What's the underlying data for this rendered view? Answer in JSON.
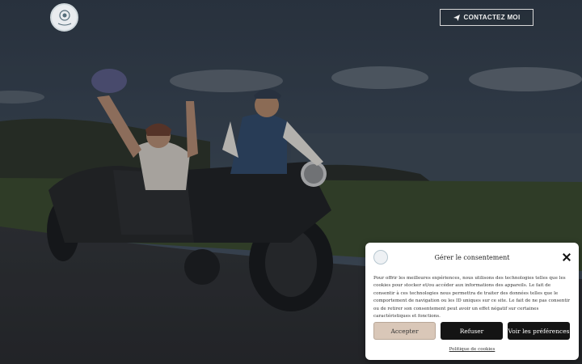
{
  "header": {
    "logo_icon": "badge-logo-icon",
    "contact_button_label": "CONTACTEZ MOI",
    "contact_icon": "send-icon"
  },
  "hero": {
    "image_description_icon": "sidecar-motorcycle-photo"
  },
  "consent": {
    "title": "Gérer le consentement",
    "close_icon": "close-icon",
    "text": "Pour offrir les meilleures expériences, nous utilisons des technologies telles que les cookies pour stocker et/ou accéder aux informations des appareils. Le fait de consentir à ces technologies nous permettra de traiter des données telles que le comportement de navigation ou les ID uniques sur ce site. Le fait de ne pas consentir ou de retirer son consentement peut avoir un effet négatif sur certaines caractéristiques et fonctions.",
    "accept_label": "Accepter",
    "refuse_label": "Refuser",
    "prefs_label": "Voir les préférences",
    "policy_link": "Politique de cookies"
  },
  "colors": {
    "accept_bg": "#d9c7b8",
    "dark_button": "#141414",
    "overlay": "#2b3138"
  }
}
